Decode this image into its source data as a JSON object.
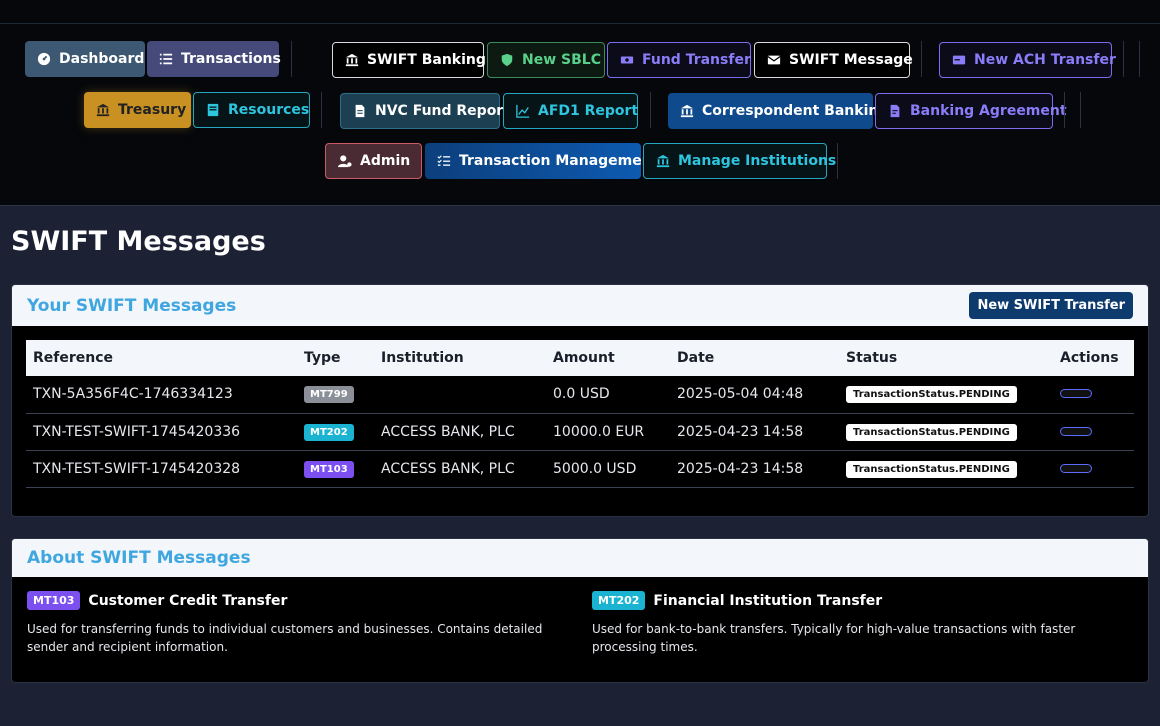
{
  "nav": {
    "dashboard": "Dashboard",
    "transactions": "Transactions",
    "swift_banking": "SWIFT Banking",
    "new_sblc": "New SBLC",
    "fund_transfer": "Fund Transfer",
    "swift_message": "SWIFT Message",
    "new_ach_transfer": "New ACH Transfer",
    "treasury": "Treasury",
    "resources": "Resources",
    "nvc_fund_report": "NVC Fund Report",
    "afd1_report": "AFD1 Report",
    "correspondent_banking": "Correspondent Banking",
    "banking_agreement": "Banking Agreement",
    "admin": "Admin",
    "transaction_management": "Transaction Management",
    "manage_institutions": "Manage Institutions"
  },
  "page": {
    "title": "SWIFT Messages"
  },
  "messages_card": {
    "title": "Your SWIFT Messages",
    "new_button": "New SWIFT Transfer",
    "columns": [
      "Reference",
      "Type",
      "Institution",
      "Amount",
      "Date",
      "Status",
      "Actions"
    ],
    "rows": [
      {
        "reference": "TXN-5A356F4C-1746334123",
        "type": "MT799",
        "institution": "",
        "amount": "0.0 USD",
        "date": "2025-05-04 04:48",
        "status": "TransactionStatus.PENDING"
      },
      {
        "reference": "TXN-TEST-SWIFT-1745420336",
        "type": "MT202",
        "institution": "ACCESS BANK, PLC",
        "amount": "10000.0 EUR",
        "date": "2025-04-23 14:58",
        "status": "TransactionStatus.PENDING"
      },
      {
        "reference": "TXN-TEST-SWIFT-1745420328",
        "type": "MT103",
        "institution": "ACCESS BANK, PLC",
        "amount": "5000.0 USD",
        "date": "2025-04-23 14:58",
        "status": "TransactionStatus.PENDING"
      }
    ]
  },
  "about_card": {
    "title": "About SWIFT Messages",
    "items": [
      {
        "badge": "MT103",
        "title": "Customer Credit Transfer",
        "desc": "Used for transferring funds to individual customers and businesses. Contains detailed sender and recipient information."
      },
      {
        "badge": "MT202",
        "title": "Financial Institution Transfer",
        "desc": "Used for bank-to-bank transfers. Typically for high-value transactions with faster processing times."
      }
    ]
  },
  "colors": {
    "accent": "#3fa6e0",
    "primary": "#0d3b6e",
    "treasury": "#c99022"
  }
}
